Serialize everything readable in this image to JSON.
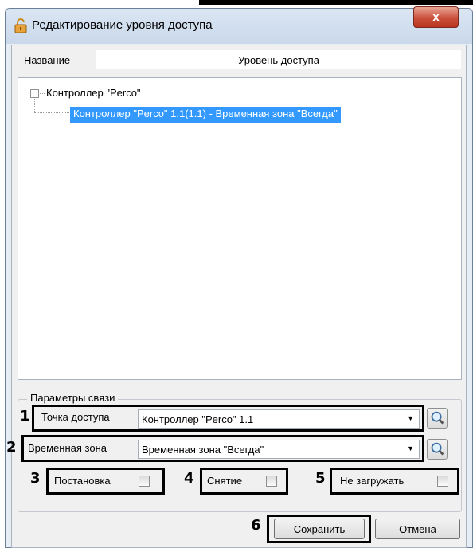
{
  "window": {
    "title": "Редактирование уровня доступа",
    "close_label": "x"
  },
  "name_row": {
    "label": "Название",
    "value": "Уровень доступа"
  },
  "tree": {
    "expander": "−",
    "root": "Контроллер \"Perco\"",
    "child": "Контроллер \"Perco\" 1.1(1.1) - Временная зона \"Всегда\""
  },
  "group": {
    "title": "Параметры связи",
    "access_point": {
      "label": "Точка доступа",
      "value": "Контроллер \"Perco\" 1.1"
    },
    "time_zone": {
      "label": "Временная зона",
      "value": "Временная зона \"Всегда\""
    },
    "arm_label": "Постановка",
    "disarm_label": "Снятие",
    "no_load_label": "Не загружать"
  },
  "buttons": {
    "save": "Сохранить",
    "cancel": "Отмена"
  },
  "callouts": [
    "1",
    "2",
    "3",
    "4",
    "5",
    "6"
  ],
  "colors": {
    "selection": "#3399ff",
    "close_button": "#c9503b",
    "frame": "#000000"
  },
  "icons": {
    "lock": "lock-icon",
    "search": "magnifier-icon",
    "dropdown": "triangle-down"
  }
}
